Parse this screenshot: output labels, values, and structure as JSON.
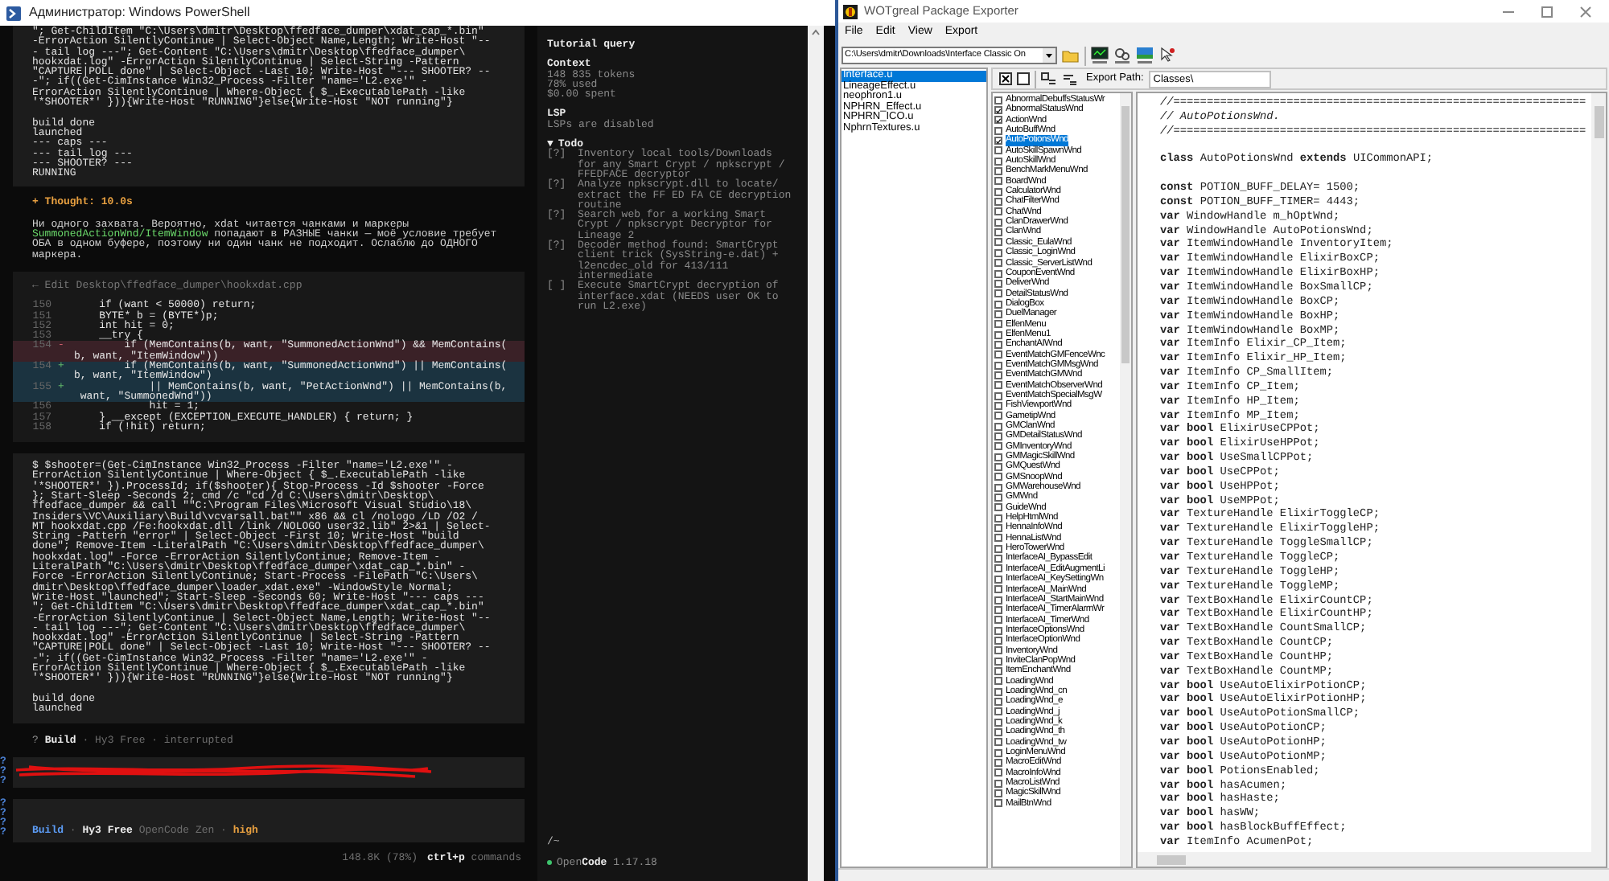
{
  "powershell": {
    "title": "Администратор: Windows PowerShell",
    "conversation": [
      {
        "kind": "tool_output",
        "command": [
          "\"; Get-ChildItem \"C:\\Users\\dmitr\\Desktop\\ffedface_dumper\\xdat_cap_*.bin\"",
          "-ErrorAction SilentlyContinue | Select-Object Name,Length; Write-Host \"--",
          "- tail log ---\"; Get-Content \"C:\\Users\\dmitr\\Desktop\\ffedface_dumper\\",
          "hookxdat.log\" -ErrorAction SilentlyContinue | Select-String -Pattern",
          "\"CAPTURE|POLL done\" | Select-Object -Last 10; Write-Host \"--- SHOOTER? --",
          "-\"; if((Get-CimInstance Win32_Process -Filter \"name='L2.exe'\" -",
          "ErrorAction SilentlyContinue | Where-Object { $_.ExecutablePath -like",
          "'*SHOOTER*' })){Write-Host \"RUNNING\"}else{Write-Host \"NOT running\"}"
        ],
        "output": [
          "build done",
          "launched",
          "--- caps ---",
          "--- tail log ---",
          "--- SHOOTER? ---",
          "RUNNING"
        ]
      },
      {
        "kind": "thought",
        "label": "+ Thought: 10.0s"
      },
      {
        "kind": "message",
        "segments": [
          {
            "kind": "plain",
            "text": "Ни одного захвата. Вероятно, xdat читается чанками и маркеры "
          },
          {
            "kind": "code",
            "text": "SummonedActionWnd/ItemWindow"
          },
          {
            "kind": "plain",
            "text": " попадают в РАЗНЫЕ чанки — моё условие требует ОБА в одном буфере, поэтому ни один чанк не подходит. Ослаблю до ОДНОГО маркера."
          }
        ]
      },
      {
        "kind": "edit",
        "header": "← Edit Desktop\\ffedface_dumper\\hookxdat.cpp",
        "lines": [
          {
            "number": "150",
            "kind": "context",
            "text": [
              "    if (want < 50000) return;"
            ]
          },
          {
            "number": "151",
            "kind": "context",
            "text": [
              "    BYTE* b = (BYTE*)p;"
            ]
          },
          {
            "number": "152",
            "kind": "context",
            "text": [
              "    int hit = 0;"
            ]
          },
          {
            "number": "153",
            "kind": "context",
            "text": [
              "    __try {"
            ]
          },
          {
            "number": "154",
            "kind": "removed",
            "sign": "-",
            "text": [
              "        if (MemContains(b, want, \"SummonedActionWnd\") && MemContains(",
              "b, want, \"ItemWindow\"))"
            ]
          },
          {
            "number": "154",
            "kind": "added",
            "sign": "+",
            "text": [
              "        if (MemContains(b, want, \"SummonedActionWnd\") || MemContains(",
              "b, want, \"ItemWindow\")"
            ]
          },
          {
            "number": "155",
            "kind": "added",
            "sign": "+",
            "text": [
              "            || MemContains(b, want, \"PetActionWnd\") || MemContains(b,",
              " want, \"SummonedWnd\"))"
            ]
          },
          {
            "number": "156",
            "kind": "context",
            "text": [
              "            hit = 1;"
            ]
          },
          {
            "number": "157",
            "kind": "context",
            "text": [
              "    } __except (EXCEPTION_EXECUTE_HANDLER) { return; }"
            ]
          },
          {
            "number": "158",
            "kind": "context",
            "text": [
              "    if (!hit) return;"
            ]
          }
        ]
      },
      {
        "kind": "tool_output",
        "command": [
          "$ $shooter=(Get-CimInstance Win32_Process -Filter \"name='L2.exe'\" -",
          "ErrorAction SilentlyContinue | Where-Object { $_.ExecutablePath -like",
          "'*SHOOTER*' }).ProcessId; if($shooter){ Stop-Process -Id $shooter -Force",
          "}; Start-Sleep -Seconds 2; cmd /c \"cd /d C:\\Users\\dmitr\\Desktop\\",
          "ffedface_dumper && call \"\"C:\\Program Files\\Microsoft Visual Studio\\18\\",
          "Insiders\\VC\\Auxiliary\\Build\\vcvarsall.bat\"\" x86 && cl /nologo /LD /O2 /",
          "MT hookxdat.cpp /Fe:hookxdat.dll /link /NOLOGO user32.lib\" 2>&1 | Select-",
          "String -Pattern \"error\" | Select-Object -First 10; Write-Host \"build",
          "done\"; Remove-Item -LiteralPath \"C:\\Users\\dmitr\\Desktop\\ffedface_dumper\\",
          "hookxdat.log\" -Force -ErrorAction SilentlyContinue; Remove-Item -",
          "LiteralPath \"C:\\Users\\dmitr\\Desktop\\ffedface_dumper\\xdat_cap_*.bin\" -",
          "Force -ErrorAction SilentlyContinue; Start-Process -FilePath \"C:\\Users\\",
          "dmitr\\Desktop\\ffedface_dumper\\loader_xdat.exe\" -WindowStyle Normal;",
          "Write-Host \"launched\"; Start-Sleep -Seconds 60; Write-Host \"--- caps ---",
          "\"; Get-ChildItem \"C:\\Users\\dmitr\\Desktop\\ffedface_dumper\\xdat_cap_*.bin\"",
          "-ErrorAction SilentlyContinue | Select-Object Name,Length; Write-Host \"--",
          "- tail log ---\"; Get-Content \"C:\\Users\\dmitr\\Desktop\\ffedface_dumper\\",
          "hookxdat.log\" -ErrorAction SilentlyContinue | Select-String -Pattern",
          "\"CAPTURE|POLL done\" | Select-Object -Last 10; Write-Host \"--- SHOOTER? --",
          "-\"; if((Get-CimInstance Win32_Process -Filter \"name='L2.exe'\" -",
          "ErrorAction SilentlyContinue | Where-Object { $_.ExecutablePath -like",
          "'*SHOOTER*' })){Write-Host \"RUNNING\"}else{Write-Host \"NOT running\"}"
        ],
        "output": [
          "build done",
          "launched"
        ]
      },
      {
        "kind": "status",
        "segments": [
          {
            "kind": "dim",
            "text": "?  "
          },
          {
            "kind": "strong",
            "text": "Build"
          },
          {
            "kind": "muted",
            "text": " · Hy3 Free · interrupted"
          }
        ]
      },
      {
        "kind": "redacted",
        "marks": [
          "?",
          "?",
          "?"
        ]
      },
      {
        "kind": "prompt",
        "marks": [
          "?",
          "?",
          "?",
          "?"
        ],
        "segments": [
          {
            "kind": "accent",
            "text": "Build"
          },
          {
            "kind": "muted",
            "text": " · "
          },
          {
            "kind": "strong",
            "text": "Hy3 Free"
          },
          {
            "kind": "muted",
            "text": " OpenCode Zen · "
          },
          {
            "kind": "warn",
            "text": "high"
          }
        ]
      }
    ],
    "footer": {
      "usage": "148.8K (78%)",
      "segments": [
        {
          "kind": "strong",
          "text": "ctrl+p"
        },
        {
          "kind": "muted",
          "text": " commands"
        }
      ]
    },
    "sidebar": {
      "title": "Tutorial query",
      "sections": [
        {
          "heading": "Context",
          "lines": [
            "148 835 tokens",
            "78% used",
            "$0.00 spent"
          ]
        },
        {
          "heading": "LSP",
          "lines": [
            "LSPs are disabled"
          ]
        }
      ],
      "todo": {
        "toggle": "▼",
        "heading": "Todo",
        "expanded": true,
        "items": [
          {
            "status": "[?]",
            "text": "Inventory local tools/Downloads for any Smart Crypt / npkscrypt / FFEDFACE decryptor"
          },
          {
            "status": "[?]",
            "text": "Analyze npkscrypt.dll to locate/ extract the FF ED FA CE decryption routine"
          },
          {
            "status": "[?]",
            "text": "Search web for a working Smart Crypt / npkscrypt Decryptor for Lineage 2"
          },
          {
            "status": "[?]",
            "text": "Decoder method found: SmartCrypt client trick (SysString-e.dat) + l2encdec_old for 413/111 intermediate"
          },
          {
            "status": "[ ]",
            "text": "Execute SmartCrypt decryption of interface.xdat (NEEDS user OK to run L2.exe)"
          }
        ]
      },
      "cwd": "/~",
      "version": [
        {
          "kind": "dim",
          "text": "Open"
        },
        {
          "kind": "strong",
          "text": "Code"
        },
        {
          "kind": "dim",
          "text": " 1.17.18"
        }
      ]
    }
  },
  "wotgreal": {
    "title": "WOTgreal Package Exporter",
    "menu": [
      "File",
      "Edit",
      "View",
      "Export"
    ],
    "path": "C:\\Users\\dmitr\\Downloads\\Interface Classic On",
    "export_path_label": "Export Path:",
    "export_path": "Classes\\",
    "packages": [
      {
        "name": "Interface.u",
        "selected": true
      },
      {
        "name": "LineageEffect.u",
        "selected": false
      },
      {
        "name": "neophron1.u",
        "selected": false
      },
      {
        "name": "NPHRN_Effect.u",
        "selected": false
      },
      {
        "name": "NPHRN_ICO.u",
        "selected": false
      },
      {
        "name": "NphrnTextures.u",
        "selected": false
      }
    ],
    "classes": [
      {
        "name": "AbnormalDebuffsStatusWr",
        "checked": false,
        "selected": false
      },
      {
        "name": "AbnormalStatusWnd",
        "checked": true,
        "selected": false
      },
      {
        "name": "ActionWnd",
        "checked": true,
        "selected": false
      },
      {
        "name": "AutoBuffWnd",
        "checked": false,
        "selected": false
      },
      {
        "name": "AutoPotionsWnd",
        "checked": true,
        "selected": true
      },
      {
        "name": "AutoSkillSpawnWnd",
        "checked": false,
        "selected": false
      },
      {
        "name": "AutoSkillWnd",
        "checked": false,
        "selected": false
      },
      {
        "name": "BenchMarkMenuWnd",
        "checked": false,
        "selected": false
      },
      {
        "name": "BoardWnd",
        "checked": false,
        "selected": false
      },
      {
        "name": "CalculatorWnd",
        "checked": false,
        "selected": false
      },
      {
        "name": "ChatFilterWnd",
        "checked": false,
        "selected": false
      },
      {
        "name": "ChatWnd",
        "checked": false,
        "selected": false
      },
      {
        "name": "ClanDrawerWnd",
        "checked": false,
        "selected": false
      },
      {
        "name": "ClanWnd",
        "checked": false,
        "selected": false
      },
      {
        "name": "Classic_EulaWnd",
        "checked": false,
        "selected": false
      },
      {
        "name": "Classic_LoginWnd",
        "checked": false,
        "selected": false
      },
      {
        "name": "Classic_ServerListWnd",
        "checked": false,
        "selected": false
      },
      {
        "name": "CouponEventWnd",
        "checked": false,
        "selected": false
      },
      {
        "name": "DeliverWnd",
        "checked": false,
        "selected": false
      },
      {
        "name": "DetailStatusWnd",
        "checked": false,
        "selected": false
      },
      {
        "name": "DialogBox",
        "checked": false,
        "selected": false
      },
      {
        "name": "DuelManager",
        "checked": false,
        "selected": false
      },
      {
        "name": "ElfenMenu",
        "checked": false,
        "selected": false
      },
      {
        "name": "ElfenMenu1",
        "checked": false,
        "selected": false
      },
      {
        "name": "EnchantAIWnd",
        "checked": false,
        "selected": false
      },
      {
        "name": "EventMatchGMFenceWnc",
        "checked": false,
        "selected": false
      },
      {
        "name": "EventMatchGMMsgWnd",
        "checked": false,
        "selected": false
      },
      {
        "name": "EventMatchGMWnd",
        "checked": false,
        "selected": false
      },
      {
        "name": "EventMatchObserverWnd",
        "checked": false,
        "selected": false
      },
      {
        "name": "EventMatchSpecialMsgW",
        "checked": false,
        "selected": false
      },
      {
        "name": "FishViewportWnd",
        "checked": false,
        "selected": false
      },
      {
        "name": "GametipWnd",
        "checked": false,
        "selected": false
      },
      {
        "name": "GMClanWnd",
        "checked": false,
        "selected": false
      },
      {
        "name": "GMDetailStatusWnd",
        "checked": false,
        "selected": false
      },
      {
        "name": "GMInventoryWnd",
        "checked": false,
        "selected": false
      },
      {
        "name": "GMMagicSkillWnd",
        "checked": false,
        "selected": false
      },
      {
        "name": "GMQuestWnd",
        "checked": false,
        "selected": false
      },
      {
        "name": "GMSnoopWnd",
        "checked": false,
        "selected": false
      },
      {
        "name": "GMWarehouseWnd",
        "checked": false,
        "selected": false
      },
      {
        "name": "GMWnd",
        "checked": false,
        "selected": false
      },
      {
        "name": "GuideWnd",
        "checked": false,
        "selected": false
      },
      {
        "name": "HelpHtmlWnd",
        "checked": false,
        "selected": false
      },
      {
        "name": "HennaInfoWnd",
        "checked": false,
        "selected": false
      },
      {
        "name": "HennaListWnd",
        "checked": false,
        "selected": false
      },
      {
        "name": "HeroTowerWnd",
        "checked": false,
        "selected": false
      },
      {
        "name": "InterfaceAI_BypassEdit",
        "checked": false,
        "selected": false
      },
      {
        "name": "InterfaceAI_EditAugmentLi",
        "checked": false,
        "selected": false
      },
      {
        "name": "InterfaceAI_KeySettingWn",
        "checked": false,
        "selected": false
      },
      {
        "name": "InterfaceAI_MainWnd",
        "checked": false,
        "selected": false
      },
      {
        "name": "InterfaceAI_StartMainWnd",
        "checked": false,
        "selected": false
      },
      {
        "name": "InterfaceAI_TimerAlarmWr",
        "checked": false,
        "selected": false
      },
      {
        "name": "InterfaceAI_TimerWnd",
        "checked": false,
        "selected": false
      },
      {
        "name": "InterfaceOptionsWnd",
        "checked": false,
        "selected": false
      },
      {
        "name": "InterfaceOptionWnd",
        "checked": false,
        "selected": false
      },
      {
        "name": "InventoryWnd",
        "checked": false,
        "selected": false
      },
      {
        "name": "InviteClanPopWnd",
        "checked": false,
        "selected": false
      },
      {
        "name": "ItemEnchantWnd",
        "checked": false,
        "selected": false
      },
      {
        "name": "LoadingWnd",
        "checked": false,
        "selected": false
      },
      {
        "name": "LoadingWnd_cn",
        "checked": false,
        "selected": false
      },
      {
        "name": "LoadingWnd_e",
        "checked": false,
        "selected": false
      },
      {
        "name": "LoadingWnd_j",
        "checked": false,
        "selected": false
      },
      {
        "name": "LoadingWnd_k",
        "checked": false,
        "selected": false
      },
      {
        "name": "LoadingWnd_th",
        "checked": false,
        "selected": false
      },
      {
        "name": "LoadingWnd_tw",
        "checked": false,
        "selected": false
      },
      {
        "name": "LoginMenuWnd",
        "checked": false,
        "selected": false
      },
      {
        "name": "MacroEditWnd",
        "checked": false,
        "selected": false
      },
      {
        "name": "MacroInfoWnd",
        "checked": false,
        "selected": false
      },
      {
        "name": "MacroListWnd",
        "checked": false,
        "selected": false
      },
      {
        "name": "MagicSkillWnd",
        "checked": false,
        "selected": false
      },
      {
        "name": "MailBtnWnd",
        "checked": false,
        "selected": false
      }
    ],
    "source": [
      {
        "kind": "comment",
        "text": "//=============================================================="
      },
      {
        "kind": "comment",
        "text": "// AutoPotionsWnd."
      },
      {
        "kind": "comment",
        "text": "//=============================================================="
      },
      {
        "kind": "blank"
      },
      {
        "kind": "code",
        "text": "**class** AutoPotionsWnd **extends** UICommonAPI;"
      },
      {
        "kind": "blank"
      },
      {
        "kind": "code",
        "text": "**const** POTION_BUFF_DELAY= 1500;"
      },
      {
        "kind": "code",
        "text": "**const** POTION_BUFF_TIMER= 4443;"
      },
      {
        "kind": "code",
        "text": "**var** WindowHandle m_hOptWnd;"
      },
      {
        "kind": "code",
        "text": "**var** WindowHandle AutoPotionsWnd;"
      },
      {
        "kind": "code",
        "text": "**var** ItemWindowHandle InventoryItem;"
      },
      {
        "kind": "code",
        "text": "**var** ItemWindowHandle ElixirBoxCP;"
      },
      {
        "kind": "code",
        "text": "**var** ItemWindowHandle ElixirBoxHP;"
      },
      {
        "kind": "code",
        "text": "**var** ItemWindowHandle BoxSmallCP;"
      },
      {
        "kind": "code",
        "text": "**var** ItemWindowHandle BoxCP;"
      },
      {
        "kind": "code",
        "text": "**var** ItemWindowHandle BoxHP;"
      },
      {
        "kind": "code",
        "text": "**var** ItemWindowHandle BoxMP;"
      },
      {
        "kind": "code",
        "text": "**var** ItemInfo Elixir_CP_Item;"
      },
      {
        "kind": "code",
        "text": "**var** ItemInfo Elixir_HP_Item;"
      },
      {
        "kind": "code",
        "text": "**var** ItemInfo CP_SmallItem;"
      },
      {
        "kind": "code",
        "text": "**var** ItemInfo CP_Item;"
      },
      {
        "kind": "code",
        "text": "**var** ItemInfo HP_Item;"
      },
      {
        "kind": "code",
        "text": "**var** ItemInfo MP_Item;"
      },
      {
        "kind": "code",
        "text": "**var bool** ElixirUseCPPot;"
      },
      {
        "kind": "code",
        "text": "**var bool** ElixirUseHPPot;"
      },
      {
        "kind": "code",
        "text": "**var bool** UseSmallCPPot;"
      },
      {
        "kind": "code",
        "text": "**var bool** UseCPPot;"
      },
      {
        "kind": "code",
        "text": "**var bool** UseHPPot;"
      },
      {
        "kind": "code",
        "text": "**var bool** UseMPPot;"
      },
      {
        "kind": "code",
        "text": "**var** TextureHandle ElixirToggleCP;"
      },
      {
        "kind": "code",
        "text": "**var** TextureHandle ElixirToggleHP;"
      },
      {
        "kind": "code",
        "text": "**var** TextureHandle ToggleSmallCP;"
      },
      {
        "kind": "code",
        "text": "**var** TextureHandle ToggleCP;"
      },
      {
        "kind": "code",
        "text": "**var** TextureHandle ToggleHP;"
      },
      {
        "kind": "code",
        "text": "**var** TextureHandle ToggleMP;"
      },
      {
        "kind": "code",
        "text": "**var** TextBoxHandle ElixirCountCP;"
      },
      {
        "kind": "code",
        "text": "**var** TextBoxHandle ElixirCountHP;"
      },
      {
        "kind": "code",
        "text": "**var** TextBoxHandle CountSmallCP;"
      },
      {
        "kind": "code",
        "text": "**var** TextBoxHandle CountCP;"
      },
      {
        "kind": "code",
        "text": "**var** TextBoxHandle CountHP;"
      },
      {
        "kind": "code",
        "text": "**var** TextBoxHandle CountMP;"
      },
      {
        "kind": "code",
        "text": "**var bool** UseAutoElixirPotionCP;"
      },
      {
        "kind": "code",
        "text": "**var bool** UseAutoElixirPotionHP;"
      },
      {
        "kind": "code",
        "text": "**var bool** UseAutoPotionSmallCP;"
      },
      {
        "kind": "code",
        "text": "**var bool** UseAutoPotionCP;"
      },
      {
        "kind": "code",
        "text": "**var bool** UseAutoPotionHP;"
      },
      {
        "kind": "code",
        "text": "**var bool** UseAutoPotionMP;"
      },
      {
        "kind": "code",
        "text": "**var bool** PotionsEnabled;"
      },
      {
        "kind": "code",
        "text": "**var bool** hasAcumen;"
      },
      {
        "kind": "code",
        "text": "**var bool** hasHaste;"
      },
      {
        "kind": "code",
        "text": "**var bool** hasWW;"
      },
      {
        "kind": "code",
        "text": "**var bool** hasBlockBuffEffect;"
      },
      {
        "kind": "code",
        "text": "**var** ItemInfo AcumenPot;"
      }
    ]
  }
}
